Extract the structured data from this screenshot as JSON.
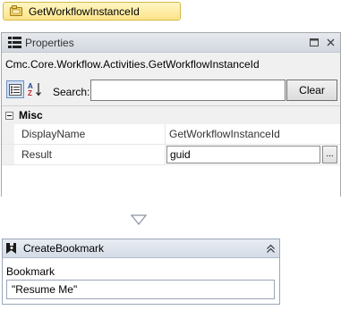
{
  "workflow_activity": {
    "name": "GetWorkflowInstanceId",
    "icon": "activity-icon"
  },
  "properties_panel": {
    "title": "Properties",
    "type_name": "Cmc.Core.Workflow.Activities.GetWorkflowInstanceId",
    "toolbar": {
      "search_label": "Search:",
      "search_value": "",
      "clear_label": "Clear"
    },
    "category": {
      "name": "Misc",
      "properties": [
        {
          "name": "DisplayName",
          "value": "GetWorkflowInstanceId"
        },
        {
          "name": "Result",
          "value": "guid",
          "ellipsis_label": "..."
        }
      ]
    }
  },
  "create_bookmark": {
    "title": "CreateBookmark",
    "field_label": "Bookmark",
    "field_value": "\"Resume Me\""
  },
  "colors": {
    "chip_fill": "#fde48a",
    "chip_border": "#d9b84a",
    "panel_header": "#d3d8e0",
    "activity_border": "#9aa6b8"
  }
}
